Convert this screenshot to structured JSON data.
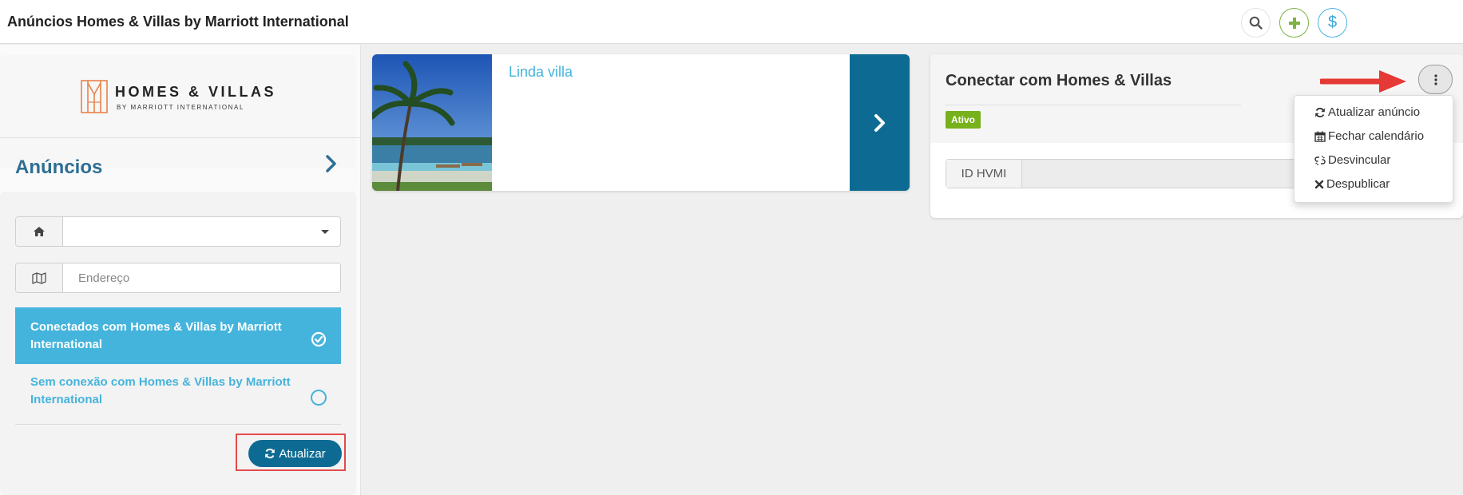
{
  "header": {
    "title": "Anúncios Homes & Villas by Marriott International",
    "actions": [
      {
        "icon": "search-icon",
        "color": "#555555"
      },
      {
        "icon": "plus-icon",
        "color": "#7cb342"
      },
      {
        "icon": "dollar-icon",
        "label": "$",
        "color": "#3aa6d8"
      }
    ]
  },
  "sidebar": {
    "logo": {
      "line1": "HOMES & VILLAS",
      "line2": "BY MARRIOTT INTERNATIONAL",
      "color": "#e8834a"
    },
    "section_title": "Anúncios",
    "property_select": {
      "value": ""
    },
    "address_input": {
      "placeholder": "Endereço",
      "value": ""
    },
    "filters": [
      {
        "label": "Conectados com Homes & Villas by Marriott International",
        "selected": true
      },
      {
        "label": "Sem conexão com Homes & Villas by Marriott International",
        "selected": false
      }
    ],
    "update_button": "Atualizar"
  },
  "listing": {
    "name": "Linda villa"
  },
  "connect_panel": {
    "title": "Conectar com Homes & Villas",
    "status": "Ativo",
    "status_color": "#77b11b",
    "id_label": "ID HVMI",
    "id_value": ""
  },
  "menu": {
    "items": [
      {
        "icon": "refresh-icon",
        "label": "Atualizar anúncio"
      },
      {
        "icon": "calendar-icon",
        "label": "Fechar calendário"
      },
      {
        "icon": "unlink-icon",
        "label": "Desvincular"
      },
      {
        "icon": "close-icon",
        "label": "Despublicar"
      }
    ]
  }
}
